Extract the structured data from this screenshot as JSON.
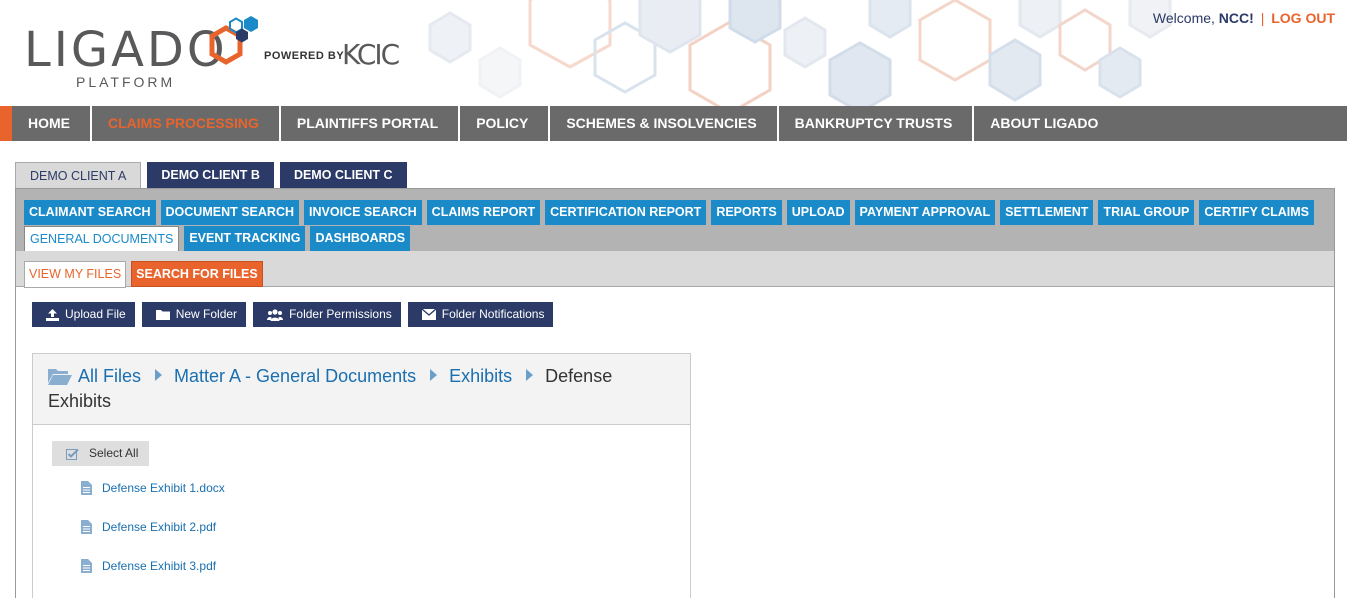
{
  "header": {
    "logo_text": "LIGADO",
    "logo_sub": "PLATFORM",
    "powered_by": "POWERED BY",
    "partner": "KCIC",
    "welcome_prefix": "Welcome,",
    "user": "NCC!",
    "separator": "|",
    "logout": "LOG OUT"
  },
  "main_nav": [
    {
      "label": "HOME"
    },
    {
      "label": "CLAIMS PROCESSING"
    },
    {
      "label": "PLAINTIFFS PORTAL"
    },
    {
      "label": "POLICY"
    },
    {
      "label": "SCHEMES & INSOLVENCIES"
    },
    {
      "label": "BANKRUPTCY TRUSTS"
    },
    {
      "label": "ABOUT LIGADO"
    }
  ],
  "client_tabs": [
    {
      "label": "DEMO CLIENT A"
    },
    {
      "label": "DEMO CLIENT B"
    },
    {
      "label": "DEMO CLIENT C"
    }
  ],
  "sub_nav_row1": [
    {
      "label": "CLAIMANT SEARCH"
    },
    {
      "label": "DOCUMENT SEARCH"
    },
    {
      "label": "INVOICE SEARCH"
    },
    {
      "label": "CLAIMS REPORT"
    },
    {
      "label": "CERTIFICATION REPORT"
    },
    {
      "label": "REPORTS"
    },
    {
      "label": "UPLOAD"
    },
    {
      "label": "PAYMENT APPROVAL"
    },
    {
      "label": "SETTLEMENT"
    },
    {
      "label": "TRIAL GROUP"
    },
    {
      "label": "CERTIFY CLAIMS"
    }
  ],
  "sub_nav_row2": [
    {
      "label": "GENERAL DOCUMENTS"
    },
    {
      "label": "EVENT TRACKING"
    },
    {
      "label": "DASHBOARDS"
    }
  ],
  "file_tabs": [
    {
      "label": "VIEW MY FILES"
    },
    {
      "label": "SEARCH FOR FILES"
    }
  ],
  "actions": [
    {
      "label": "Upload File",
      "icon": "upload-icon"
    },
    {
      "label": "New Folder",
      "icon": "folder-icon"
    },
    {
      "label": "Folder Permissions",
      "icon": "users-icon"
    },
    {
      "label": "Folder Notifications",
      "icon": "envelope-icon"
    }
  ],
  "breadcrumb": {
    "items": [
      "All Files",
      "Matter A - General Documents",
      "Exhibits"
    ],
    "current": "Defense Exhibits"
  },
  "select_all": "Select All",
  "files": [
    {
      "name": "Defense Exhibit 1.docx"
    },
    {
      "name": "Defense Exhibit 2.pdf"
    },
    {
      "name": "Defense Exhibit 3.pdf"
    }
  ],
  "colors": {
    "orange": "#e8642c",
    "navy": "#2b3a67",
    "blue": "#1a8ac9",
    "nav_gray": "#6a6a6a"
  }
}
